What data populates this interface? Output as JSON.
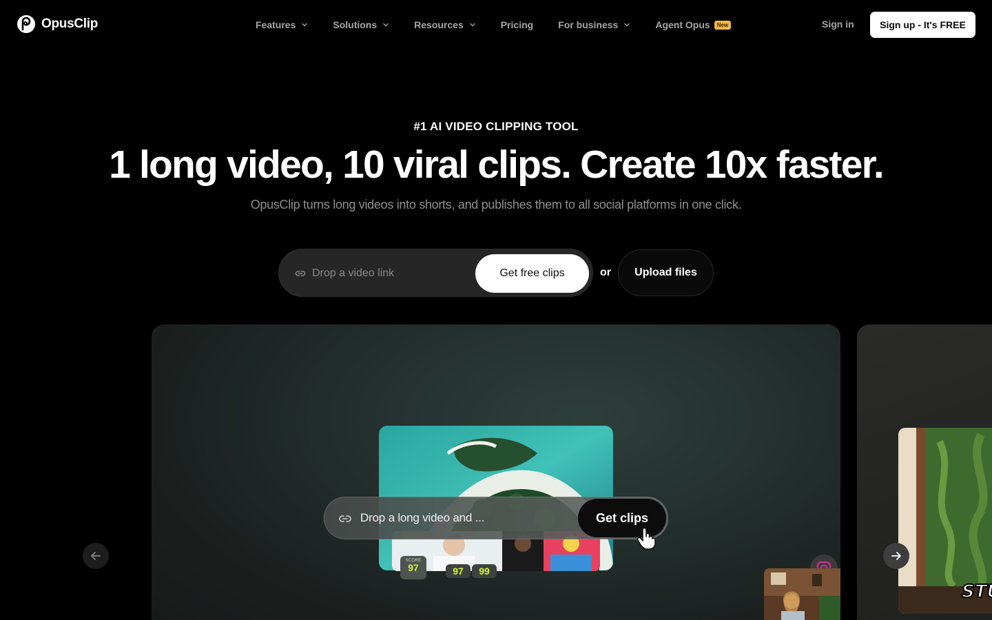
{
  "brand": {
    "name": "OpusClip"
  },
  "nav": {
    "items": [
      {
        "label": "Features",
        "dropdown": true
      },
      {
        "label": "Solutions",
        "dropdown": true
      },
      {
        "label": "Resources",
        "dropdown": true
      },
      {
        "label": "Pricing",
        "dropdown": false
      },
      {
        "label": "For business",
        "dropdown": true
      },
      {
        "label": "Agent Opus",
        "dropdown": false,
        "badge": "New"
      }
    ],
    "sign_in": "Sign in",
    "sign_up": "Sign up - It's FREE"
  },
  "hero": {
    "eyebrow": "#1 AI VIDEO CLIPPING TOOL",
    "headline": "1 long video, 10 viral clips. Create 10x faster.",
    "subhead": "OpusClip turns long videos into shorts, and publishes them to all social platforms in one click.",
    "link_placeholder": "Drop a video link",
    "get_free_clips": "Get free clips",
    "or": "or",
    "upload_files": "Upload files"
  },
  "showcase": {
    "mini_input_text": "Drop a long video and ...",
    "mini_button": "Get clips",
    "score_label": "SCORE",
    "score_value": "97",
    "score_ghost_1": "97",
    "score_ghost_2": "99"
  },
  "colors": {
    "background": "#000000",
    "nav_text": "#a6a6a6",
    "badge": "#f2b544",
    "score_accent": "#d7f53b"
  },
  "icons": {
    "logo": "opusclip-logo-icon",
    "link": "link-icon",
    "chevron": "chevron-down-icon",
    "arrow_left": "arrow-left-icon",
    "arrow_right": "arrow-right-icon",
    "cursor": "hand-cursor-icon",
    "instagram": "instagram-icon"
  }
}
